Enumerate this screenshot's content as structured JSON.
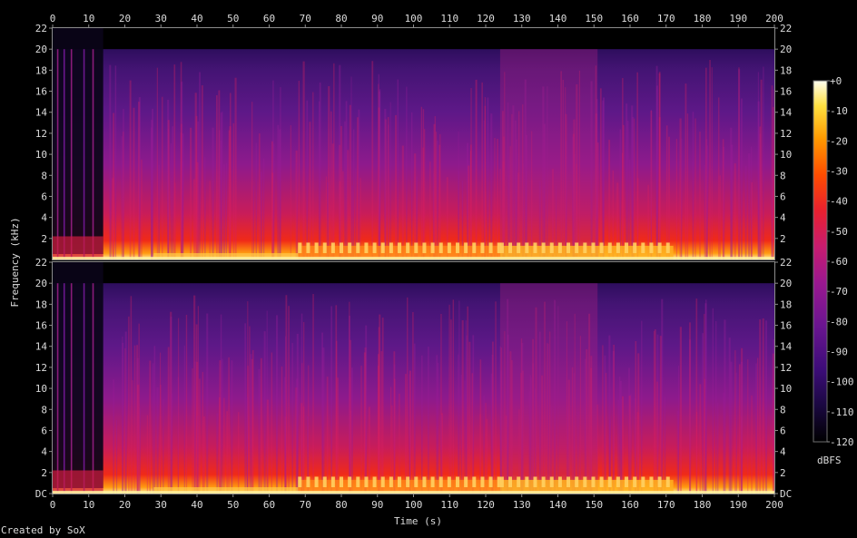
{
  "chart_data": {
    "type": "heatmap",
    "title": "",
    "xlabel": "Time (s)",
    "ylabel": "Frequency (kHz)",
    "xlim": [
      0,
      200
    ],
    "x_ticks": [
      0,
      10,
      20,
      30,
      40,
      50,
      60,
      70,
      80,
      90,
      100,
      110,
      120,
      130,
      140,
      150,
      160,
      170,
      180,
      190,
      200
    ],
    "channels": [
      {
        "ylim": [
          0,
          22
        ],
        "y_ticks": [
          2,
          4,
          6,
          8,
          10,
          12,
          14,
          16,
          18,
          20,
          22
        ],
        "y_tick_labels": [
          "2",
          "4",
          "6",
          "8",
          "10",
          "12",
          "14",
          "16",
          "18",
          "20",
          "22"
        ]
      },
      {
        "ylim": [
          0,
          22
        ],
        "y_ticks": [
          0,
          2,
          4,
          6,
          8,
          10,
          12,
          14,
          16,
          18,
          20,
          22
        ],
        "y_tick_labels": [
          "DC",
          "2",
          "4",
          "6",
          "8",
          "10",
          "12",
          "14",
          "16",
          "18",
          "20",
          "22"
        ]
      }
    ],
    "colorbar": {
      "label": "dBFS",
      "range": [
        -120,
        0
      ],
      "ticks": [
        0,
        -10,
        -20,
        -30,
        -40,
        -50,
        -60,
        -70,
        -80,
        -90,
        -100,
        -110,
        -120
      ],
      "tick_labels": [
        "+0",
        "-10",
        "-20",
        "-30",
        "-40",
        "-50",
        "-60",
        "-70",
        "-80",
        "-90",
        "-100",
        "-110",
        "-120"
      ],
      "colors": [
        "#000000",
        "#1a0840",
        "#3c0c78",
        "#6a1590",
        "#9a1890",
        "#c81c70",
        "#e8202f",
        "#ff4d00",
        "#ff9a00",
        "#ffe040",
        "#fffff0"
      ]
    },
    "grid": false,
    "lowpass_cutoff_khz": 20,
    "loud_sections_s": [
      [
        68,
        124
      ],
      [
        124,
        172
      ]
    ],
    "bright_band_s": [
      124,
      151
    ],
    "quiet_intro_s": [
      0,
      14
    ]
  },
  "footer": {
    "credit": "Created by SoX"
  }
}
